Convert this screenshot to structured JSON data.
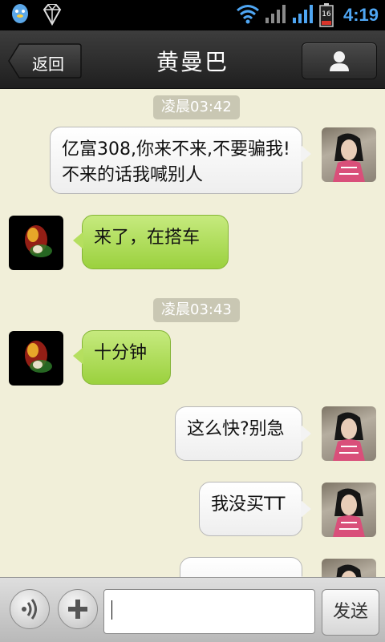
{
  "status_bar": {
    "time": "4:19",
    "battery_level": "16",
    "icons": [
      "qq-penguin-icon",
      "diamond-icon",
      "wifi-icon",
      "signal-icon",
      "signal-icon",
      "battery-icon"
    ]
  },
  "header": {
    "back_label": "返回",
    "title": "黄曼巴",
    "profile_icon": "person-icon"
  },
  "colors": {
    "status_bar_bg": "#000000",
    "title_bar_bg": "#2b2b2b",
    "chat_bg": "#f1efd9",
    "bubble_sent": "#ffffff",
    "bubble_received": "#a8d94d",
    "timestamp_bg": "#c9c7b3",
    "clock": "#4fa6f3"
  },
  "messages": [
    {
      "type": "timestamp",
      "text": "凌晨03:42"
    },
    {
      "type": "sent",
      "lines": [
        "亿富308,你来不来,不要骗我!",
        "不来的话我喊别人"
      ],
      "avatar": "girl-avatar"
    },
    {
      "type": "received",
      "lines": [
        "来了，在搭车"
      ],
      "avatar": "dark-avatar"
    },
    {
      "type": "timestamp",
      "text": "凌晨03:43"
    },
    {
      "type": "received",
      "lines": [
        "十分钟"
      ],
      "avatar": "dark-avatar"
    },
    {
      "type": "sent",
      "lines": [
        "这么快?别急"
      ],
      "avatar": "girl-avatar"
    },
    {
      "type": "sent",
      "lines": [
        "我没买TT"
      ],
      "avatar": "girl-avatar"
    }
  ],
  "input_bar": {
    "voice_icon": "voice-icon",
    "plus_icon": "plus-icon",
    "input_value": "",
    "send_label": "发送"
  }
}
